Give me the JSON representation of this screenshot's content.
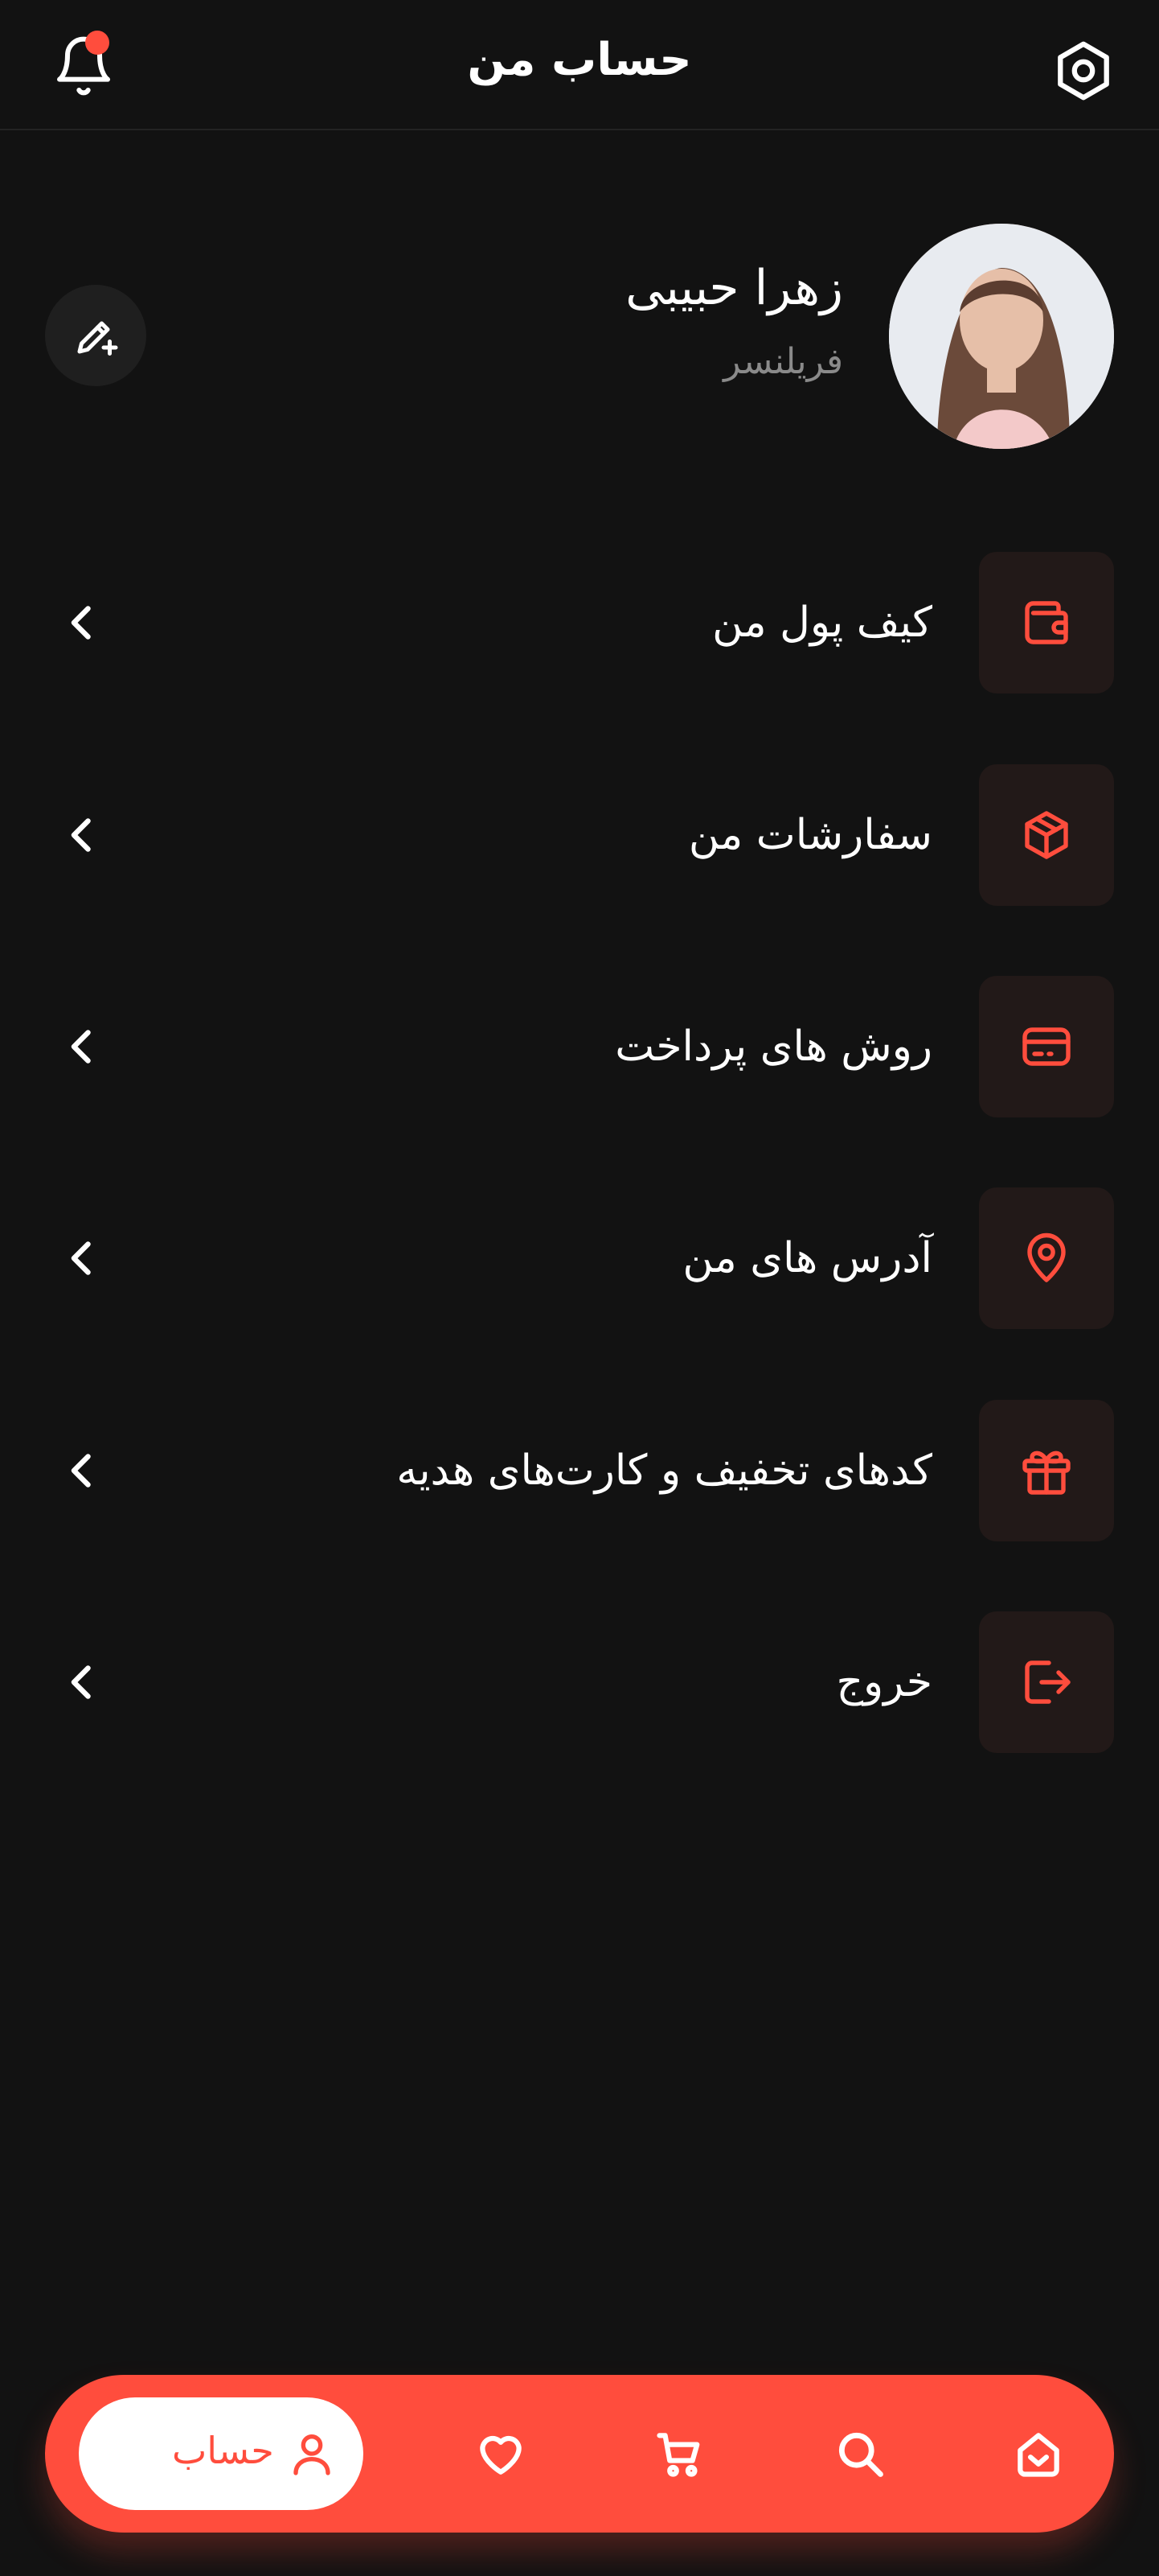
{
  "header": {
    "title": "حساب من",
    "notification_icon": "bell-icon",
    "settings_icon": "hexagon-settings-icon",
    "has_unread_notification": true
  },
  "profile": {
    "name": "زهرا حبیبی",
    "role": "فریلنسر",
    "edit_icon": "pencil-plus-icon"
  },
  "menu": {
    "items": [
      {
        "label": "کیف پول من",
        "icon": "wallet-icon"
      },
      {
        "label": "سفارشات من",
        "icon": "box-icon"
      },
      {
        "label": "روش های پرداخت",
        "icon": "credit-card-icon"
      },
      {
        "label": "آدرس های من",
        "icon": "location-pin-icon"
      },
      {
        "label": "کدهای تخفیف و کارت‌های هدیه",
        "icon": "gift-icon"
      },
      {
        "label": "خروج",
        "icon": "logout-icon"
      }
    ]
  },
  "bottom_nav": {
    "active": {
      "label": "حساب",
      "icon": "user-icon"
    },
    "items": [
      {
        "icon": "heart-icon"
      },
      {
        "icon": "cart-icon"
      },
      {
        "icon": "search-icon"
      },
      {
        "icon": "home-icon"
      }
    ]
  },
  "colors": {
    "background": "#121212",
    "accent": "#ff4d3d",
    "icon_box": "#221918",
    "muted_text": "#8a8a8a"
  }
}
